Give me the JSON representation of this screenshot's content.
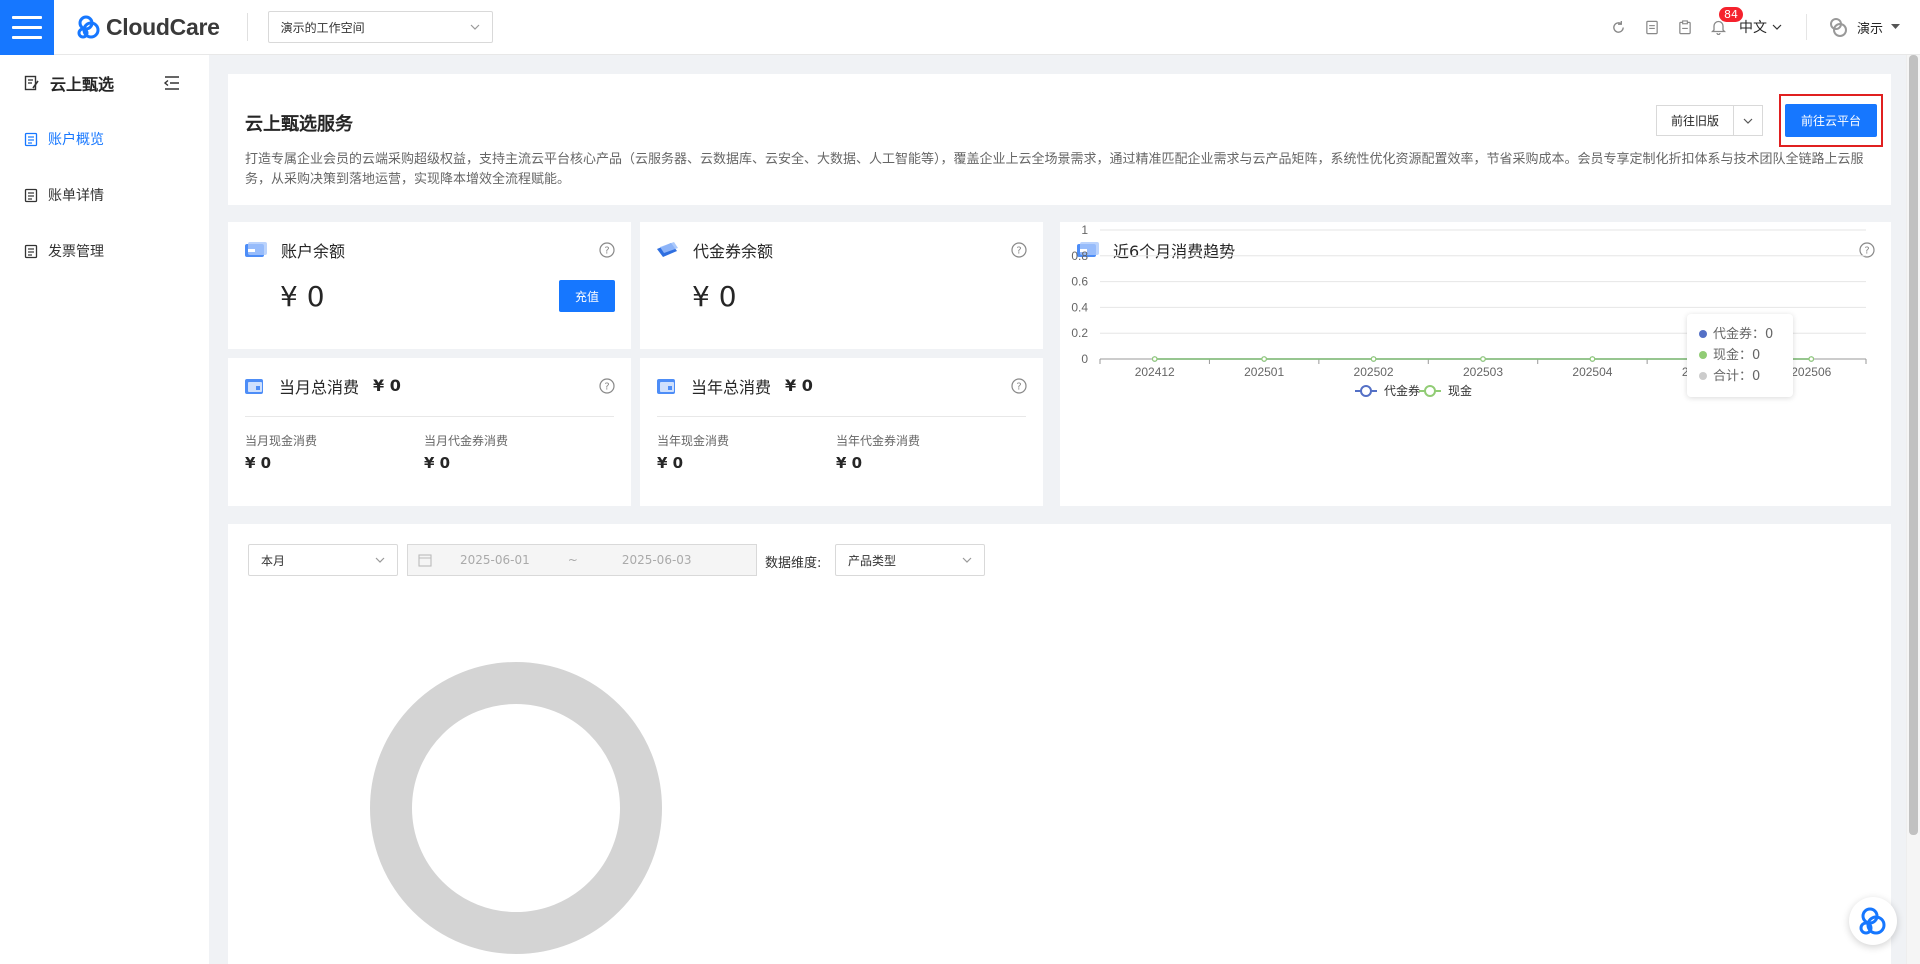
{
  "header": {
    "brand": "CloudCare",
    "workspace": "演示的工作空间",
    "notification_count": "84",
    "language": "中文",
    "user": "演示"
  },
  "sidebar": {
    "title": "云上甄选",
    "items": [
      {
        "label": "账户概览",
        "active": true
      },
      {
        "label": "账单详情",
        "active": false
      },
      {
        "label": "发票管理",
        "active": false
      }
    ]
  },
  "service": {
    "title": "云上甄选服务",
    "description": "打造专属企业会员的云端采购超级权益，支持主流云平台核心产品（云服务器、云数据库、云安全、大数据、人工智能等），覆盖企业上云全场景需求，通过精准匹配企业需求与云产品矩阵，系统性优化资源配置效率，节省采购成本。会员专享定制化折扣体系与技术团队全链路上云服务，从采购决策到落地运营，实现降本增效全流程赋能。",
    "old_version_label": "前往旧版",
    "cloud_platform_label": "前往云平台"
  },
  "account_balance": {
    "title": "账户余额",
    "amount": "¥ 0",
    "recharge_label": "充值"
  },
  "voucher_balance": {
    "title": "代金券余额",
    "amount": "¥ 0"
  },
  "monthly": {
    "title": "当月总消费",
    "total": "¥ 0",
    "cash_label": "当月现金消费",
    "cash_value": "¥ 0",
    "voucher_label": "当月代金券消费",
    "voucher_value": "¥ 0"
  },
  "yearly": {
    "title": "当年总消费",
    "total": "¥ 0",
    "cash_label": "当年现金消费",
    "cash_value": "¥ 0",
    "voucher_label": "当年代金券消费",
    "voucher_value": "¥ 0"
  },
  "trend": {
    "title": "近6个月消费趋势",
    "tooltip": [
      {
        "label": "代金券：",
        "value": "0",
        "color": "#5470c6"
      },
      {
        "label": "现金：",
        "value": "0",
        "color": "#91cc75"
      },
      {
        "label": "合计：",
        "value": "0",
        "color": "#cccccc"
      }
    ]
  },
  "chart_data": {
    "type": "line",
    "x": [
      "202412",
      "202501",
      "202502",
      "202503",
      "202504",
      "202505",
      "202506"
    ],
    "yticks": [
      "0",
      "0.2",
      "0.4",
      "0.6",
      "0.8",
      "1"
    ],
    "ylim": [
      0,
      1
    ],
    "grid": true,
    "legend_position": "bottom",
    "series": [
      {
        "name": "代金券",
        "values": [
          0,
          0,
          0,
          0,
          0,
          0,
          0
        ],
        "color": "#5470c6"
      },
      {
        "name": "现金",
        "values": [
          0,
          0,
          0,
          0,
          0,
          0,
          0
        ],
        "color": "#91cc75"
      }
    ]
  },
  "filters": {
    "period": "本月",
    "start_date": "2025-06-01",
    "range_sep": "~",
    "end_date": "2025-06-03",
    "dimension_label": "数据维度:",
    "dimension_value": "产品类型"
  },
  "colors": {
    "primary": "#1677ff",
    "alert": "#e02020",
    "ring": "#d4d4d4"
  }
}
